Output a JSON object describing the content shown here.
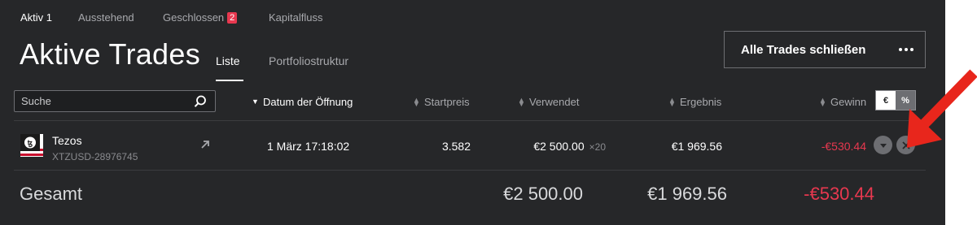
{
  "tabs": [
    {
      "label": "Aktiv",
      "count": "1"
    },
    {
      "label": "Ausstehend"
    },
    {
      "label": "Geschlossen",
      "badge": "2"
    },
    {
      "label": "Kapitalfluss"
    }
  ],
  "page": {
    "title": "Aktive Trades",
    "subtabs": [
      "Liste",
      "Portfoliostruktur"
    ],
    "close_all_label": "Alle Trades schließen",
    "more_icon": "ellipsis-icon"
  },
  "search": {
    "placeholder": "Suche",
    "icon": "search-icon"
  },
  "columns": {
    "date": "Datum der Öffnung",
    "start_price": "Startpreis",
    "used": "Verwendet",
    "result": "Ergebnis",
    "profit": "Gewinn"
  },
  "unit_toggle": {
    "euro": "€",
    "percent": "%",
    "selected": "%"
  },
  "trades": [
    {
      "name": "Tezos",
      "id": "XTZUSD-28976745",
      "opened": "1 März 17:18:02",
      "start_price": "3.582",
      "used": "€2 500.00",
      "multiplier": "×20",
      "result": "€1 969.56",
      "profit": "-€530.44"
    }
  ],
  "totals": {
    "label": "Gesamt",
    "used": "€2 500.00",
    "result": "€1 969.56",
    "profit": "-€530.44"
  },
  "colors": {
    "background": "#262729",
    "negative": "#e8384f",
    "annotation_arrow": "#e8261c"
  }
}
